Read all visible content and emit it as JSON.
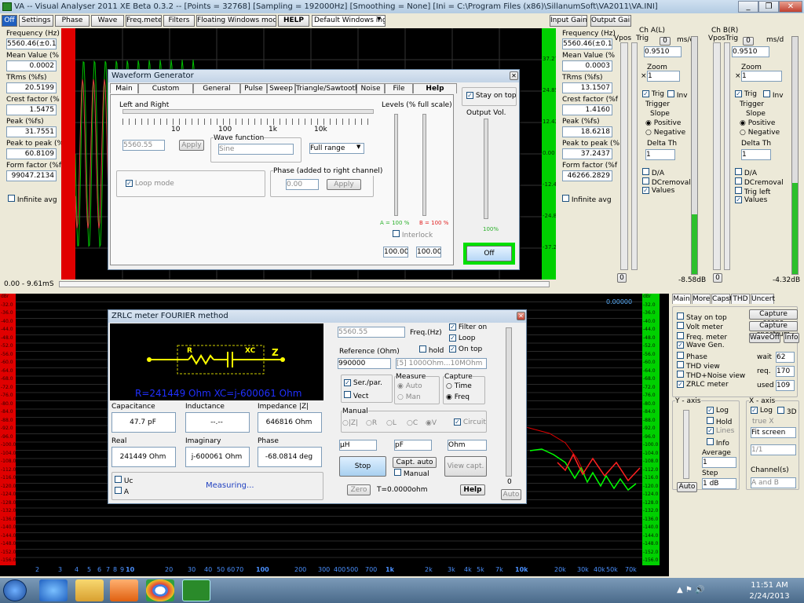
{
  "window": {
    "title": "VA -- Visual Analyser 2011 XE Beta 0.3.2 --  [Points = 32768]  [Sampling = 192000Hz]  [Smoothing = None]  [Ini = C:\\Program Files (x86)\\SillanumSoft\\VA2011\\VA.INI]",
    "min": "_",
    "max": "❐",
    "close": "✕"
  },
  "toolbar": {
    "off": "Off",
    "settings": "Settings",
    "phase": "Phase",
    "wave": "Wave",
    "freqmeter": "Freq.meter",
    "filters": "Filters",
    "floating": "Floating Windows mode",
    "help": "HELP",
    "layout": "Default Windows ing",
    "input_gain": "Input Gain",
    "output_gain": "Output Gain"
  },
  "left_panel": {
    "items": [
      {
        "label": "Frequency (Hz)",
        "value": "5560.46(±0.1"
      },
      {
        "label": "Mean Value (%",
        "value": "0.0002"
      },
      {
        "label": "TRms (%fs)",
        "value": "20.5199"
      },
      {
        "label": "Crest factor (%",
        "value": "1.5475"
      },
      {
        "label": "Peak (%fs)",
        "value": "31.7551"
      },
      {
        "label": "Peak to peak (%",
        "value": "60.8109"
      },
      {
        "label": "Form factor (%f",
        "value": "99047.2134"
      }
    ],
    "infinite": "Infinite avg"
  },
  "right_panel": {
    "items": [
      {
        "label": "Frequency (Hz)",
        "value": "5560.46(±0.1"
      },
      {
        "label": "Mean Value (%",
        "value": "0.0003"
      },
      {
        "label": "TRms (%fs)",
        "value": "13.1507"
      },
      {
        "label": "Crest factor (%f",
        "value": "1.4160"
      },
      {
        "label": "Peak (%fs)",
        "value": "18.6218"
      },
      {
        "label": "Peak to peak (%",
        "value": "37.2437"
      },
      {
        "label": "Form factor (%f",
        "value": "46266.2829"
      }
    ],
    "infinite": "Infinite avg"
  },
  "chA": {
    "title": "Ch A(L)",
    "vpos": "Vpos",
    "trig": "Trig",
    "ms": "ms/d",
    "zero": "0",
    "ms_value": "0.9510",
    "zoom": "Zoom",
    "zoom_value": "1",
    "x": "×",
    "trig_chk": "Trig",
    "inv": "Inv",
    "trigger": "Trigger",
    "slope": "Slope",
    "positive": "Positive",
    "negative": "Negative",
    "delta": "Delta Th",
    "delta_value": "1",
    "da": "D/A",
    "dcremoval": "DCremoval",
    "values": "Values",
    "bottom_zero": "0",
    "db": "-8.58dB"
  },
  "chB": {
    "title": "Ch B(R)",
    "vpos": "Vpos",
    "trig": "Trig",
    "ms": "ms/d",
    "zero": "0",
    "ms_value": "0.9510",
    "zoom": "Zoom",
    "zoom_value": "1",
    "x": "×",
    "trig_chk": "Trig",
    "inv": "Inv",
    "trigger": "Trigger",
    "slope": "Slope",
    "positive": "Positive",
    "negative": "Negative",
    "delta": "Delta Th",
    "delta_value": "1",
    "da": "D/A",
    "dcremoval": "DCremoval",
    "trigleft": "Trig left",
    "values": "Values",
    "bottom_zero": "0",
    "db": "-4.32dB"
  },
  "scope": {
    "range": "0.00 - 9.61mS",
    "ticks_right": [
      "37.27",
      "24.85",
      "12.42",
      "0.00",
      "-12.42",
      "-24.85",
      "-37.27"
    ]
  },
  "waveform": {
    "title": "Waveform Generator",
    "tabs": [
      "Main",
      "Custom Function",
      "General setup",
      "Pulse",
      "Sweep",
      "Triangle/Sawtooth",
      "Noise",
      "File",
      "Help"
    ],
    "left_right": "Left and  Right",
    "scale": [
      "10",
      "100",
      "1k",
      "10k"
    ],
    "freq_value": "5560.55",
    "apply": "Apply",
    "wave_function": "Wave function",
    "wave_value": "Sine",
    "full_range": "Full range",
    "loop_mode": "Loop mode",
    "phase_label": "Phase (added to right channel)",
    "phase_value": "0.00",
    "phase_apply": "Apply",
    "levels": "Levels (% full scale)",
    "a_level": "A = 100 %",
    "b_level": "B = 100 %",
    "interlock": "Interlock",
    "a_value": "100.00",
    "b_value": "100.00",
    "stay_on_top": "Stay on top",
    "output_vol": "Output Vol.",
    "vol_pct": "100%",
    "off": "Off"
  },
  "spectrum": {
    "xticks": [
      "2",
      "3",
      "4",
      "5",
      "6",
      "7",
      "8",
      "9",
      "10",
      "20",
      "30",
      "40",
      "50",
      "60",
      "70",
      "100",
      "200",
      "300",
      "400",
      "500",
      "700",
      "1k",
      "2k",
      "3k",
      "4k",
      "5k",
      "7k",
      "10k",
      "20k",
      "30k",
      "40k",
      "50k",
      "70k"
    ],
    "yticks_left": [
      "dBr",
      "-32.0",
      "-36.0",
      "-40.0",
      "-44.0",
      "-48.0",
      "-52.0",
      "-56.0",
      "-60.0",
      "-64.0",
      "-68.0",
      "-72.0",
      "-76.0",
      "-80.0",
      "-84.0",
      "-88.0",
      "-92.0",
      "-96.0",
      "-100.0",
      "-104.0",
      "-108.0",
      "-112.0",
      "-116.0",
      "-120.0",
      "-124.0",
      "-128.0",
      "-132.0",
      "-136.0",
      "-140.0",
      "-144.0",
      "-148.0",
      "-152.0",
      "-156.0"
    ],
    "yticks_right": [
      "dBr",
      "-32.0",
      "-36.0",
      "-40.0",
      "-44.0",
      "-48.0",
      "-52.0",
      "-56.0",
      "-60.0",
      "-64.0",
      "-68.0",
      "-72.0",
      "-76.0",
      "-80.0",
      "-84.0",
      "-88.0",
      "-92.0",
      "-96.0",
      "-100.0",
      "-104.0",
      "-108.0",
      "-112.0",
      "-116.0",
      "-120.0",
      "-124.0",
      "-128.0",
      "-132.0",
      "-136.0",
      "-140.0",
      "-144.0",
      "-148.0",
      "-152.0",
      "-156.0"
    ],
    "hz": "Hz",
    "readout": "0.00000"
  },
  "zrlc": {
    "title": "ZRLC meter FOURIER method",
    "r_label": "R",
    "xc_label": "XC",
    "z_label": "Z",
    "result": "R=241449 Ohm  XC=j-600061 Ohm",
    "capacitance": "Capacitance",
    "cap_value": "47.7 pF",
    "inductance": "Inductance",
    "ind_value": "--.--",
    "impedance": "Impedance |Z|",
    "imp_value": "646816 Ohm",
    "real": "Real",
    "real_value": "241449 Ohm",
    "imaginary": "Imaginary",
    "imag_value": "j-600061 Ohm",
    "phase": "Phase",
    "phase_value": "-68.0814 deg",
    "uc": "Uc",
    "a": "A",
    "measuring": "Measuring...",
    "freq_value": "5560.55",
    "freq_label": "Freq.(Hz)",
    "filter_on": "Filter on",
    "loop": "Loop",
    "on_top": "On top",
    "reference": "Reference (Ohm)",
    "hold": "hold",
    "ref_value": "990000",
    "ref_range": "[5] 1000Ohm...10MOhm",
    "ser_par": "Ser./par.",
    "vect": "Vect",
    "measure": "Measure",
    "auto": "Auto",
    "man": "Man",
    "capture": "Capture",
    "time": "Time",
    "freq": "Freq",
    "manual": "Manual",
    "z": "|Z|",
    "r": "R",
    "l": "L",
    "c": "C",
    "v": "V",
    "circuit": "Circuit",
    "uh": "µH",
    "pf": "pF",
    "ohm": "Ohm",
    "stop": "Stop",
    "capt_auto": "Capt. auto",
    "manual_chk": "Manual",
    "view_capt": "View capt.",
    "zero": "Zero",
    "t_value": "T=0.0000ohm",
    "help": "Help",
    "slider_zero": "0",
    "auto_btn": "Auto",
    "close": "✕"
  },
  "spec_panel": {
    "tabs": [
      "Main",
      "More",
      "Capst",
      "THD",
      "Uncert"
    ],
    "checks": [
      "Stay on top",
      "Volt meter",
      "Freq. meter",
      "Wave Gen.",
      "Phase",
      "THD view",
      "THD+Noise view",
      "ZRLC meter"
    ],
    "capture_scope": "Capture scope",
    "capture_spectrum": "Capture spectrum",
    "waveoff": "WaveOff",
    "info": "Info",
    "wait": "wait",
    "wait_v": "62",
    "req": "req.",
    "req_v": "170",
    "used": "used",
    "used_v": "109",
    "y_axis": "Y - axis",
    "log": "Log",
    "hold": "Hold",
    "lines": "Lines",
    "info2": "Info",
    "average": "Average",
    "avg_v": "1",
    "step": "Step",
    "step_v": "1 dB",
    "auto": "Auto",
    "x_axis": "X - axis",
    "xlog": "Log",
    "x3d": "3D",
    "truex": "true X",
    "fit": "Fit screen",
    "ratio": "1/1",
    "channels": "Channel(s)",
    "ch_v": "A and B"
  },
  "taskbar": {
    "time": "11:51 AM",
    "date": "2/24/2013"
  }
}
